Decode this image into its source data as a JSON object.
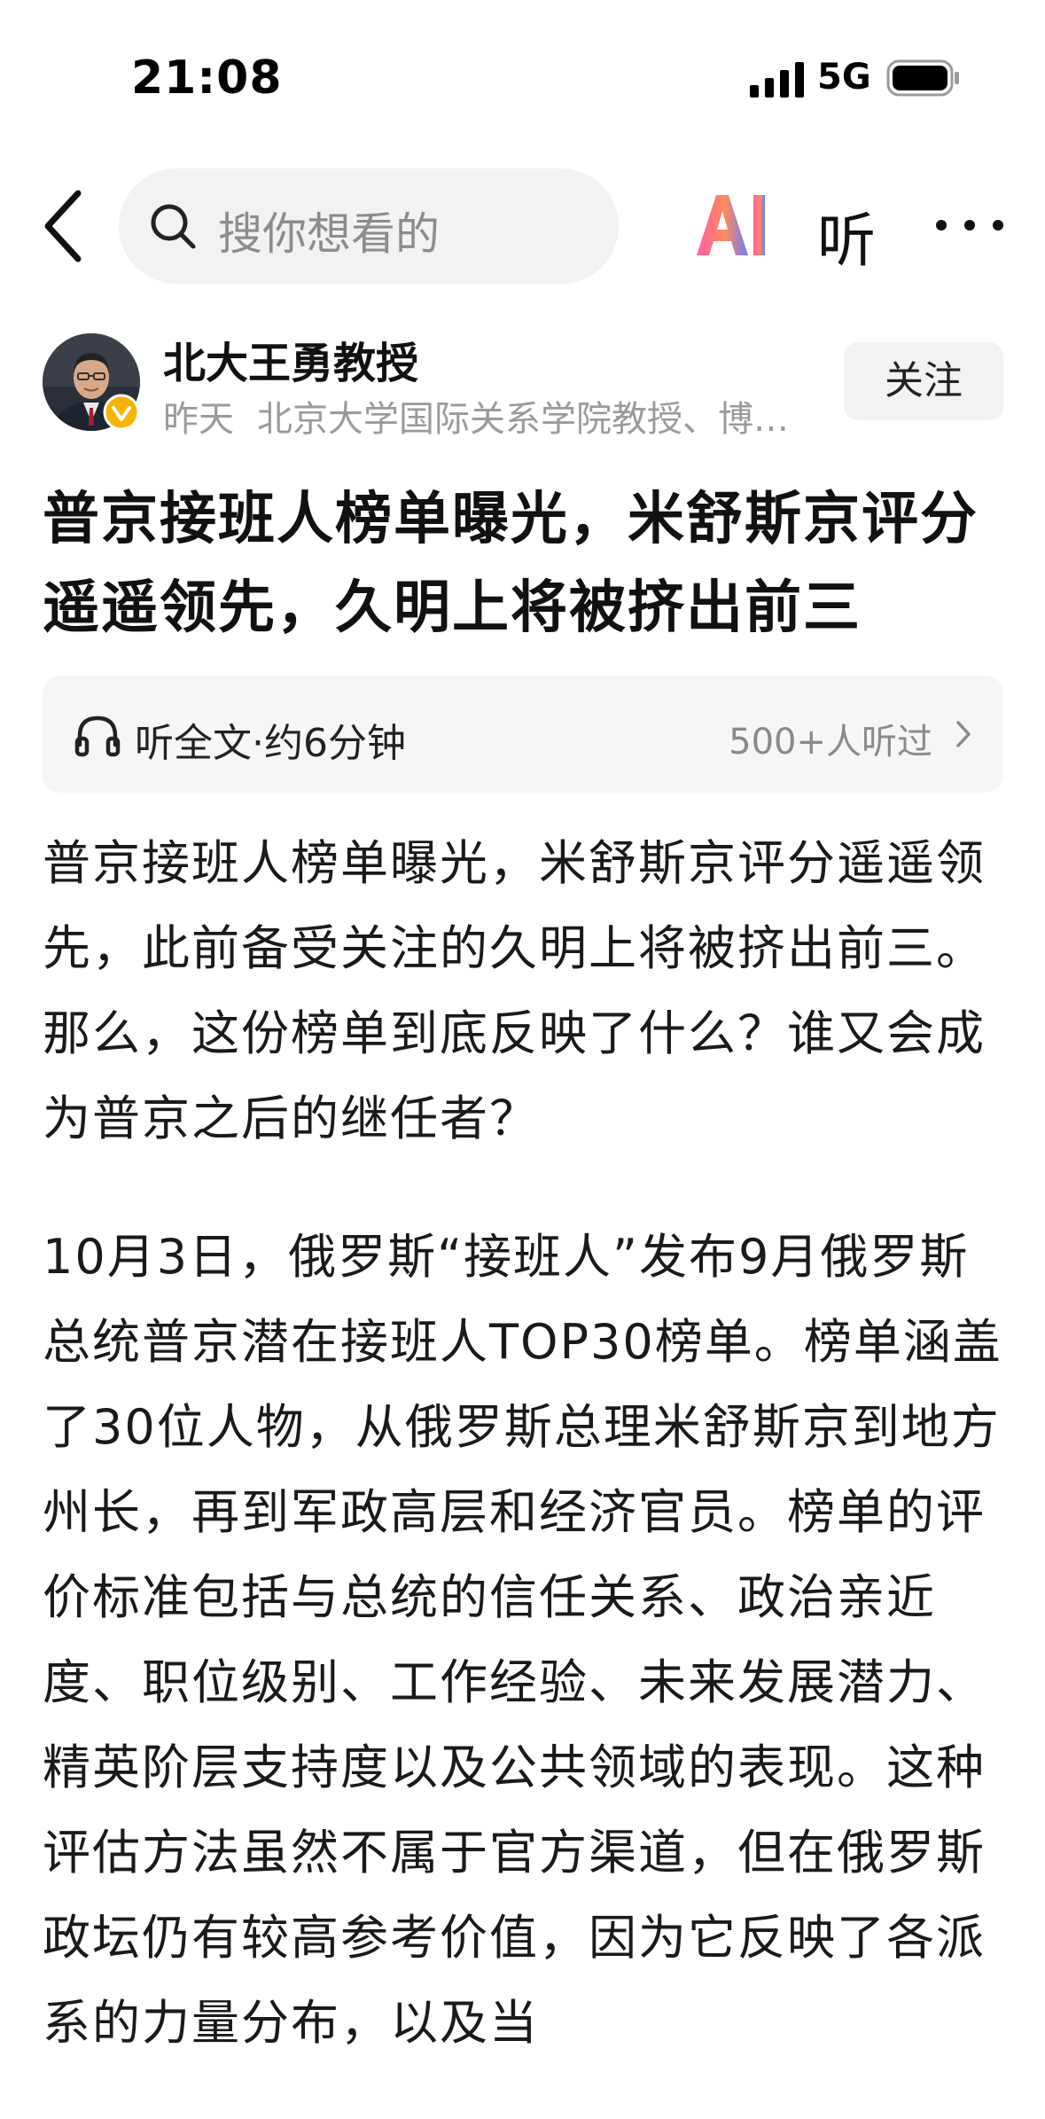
{
  "status_bar": {
    "time": "21:08",
    "network": "5G",
    "icons": [
      "signal-icon",
      "battery-icon"
    ]
  },
  "nav": {
    "back_icon": "chevron-left-icon",
    "search_placeholder": "搜你想看的",
    "ai_label": "AI",
    "listen_label": "听",
    "more_icon": "more-dots-icon"
  },
  "author": {
    "name": "北大王勇教授",
    "time": "昨天",
    "description": "北京大学国际关系学院教授、博…",
    "follow_label": "关注",
    "verified_color": "#f5b400"
  },
  "article": {
    "title": "普京接班人榜单曝光，米舒斯京评分遥遥领先，久明上将被挤出前三",
    "listen_bar": {
      "label": "听全文·约6分钟",
      "count": "500+人听过"
    },
    "paragraphs": [
      "普京接班人榜单曝光，米舒斯京评分遥遥领先，此前备受关注的久明上将被挤出前三。那么，这份榜单到底反映了什么？谁又会成为普京之后的继任者？",
      "10月3日，俄罗斯“接班人”发布9月俄罗斯总统普京潜在接班人TOP30榜单。榜单涵盖了30位人物，从俄罗斯总理米舒斯京到地方州长，再到军政高层和经济官员。榜单的评价标准包括与总统的信任关系、政治亲近度、职位级别、工作经验、未来发展潜力、精英阶层支持度以及公共领域的表现。这种评估方法虽然不属于官方渠道，但在俄罗斯政坛仍有较高参考价值，因为它反映了各派系的力量分布，以及当"
    ]
  },
  "colors": {
    "ai_gradient_start": "#ff5fa2",
    "ai_gradient_end": "#6b7bff",
    "muted_text": "#9a9a9a"
  }
}
